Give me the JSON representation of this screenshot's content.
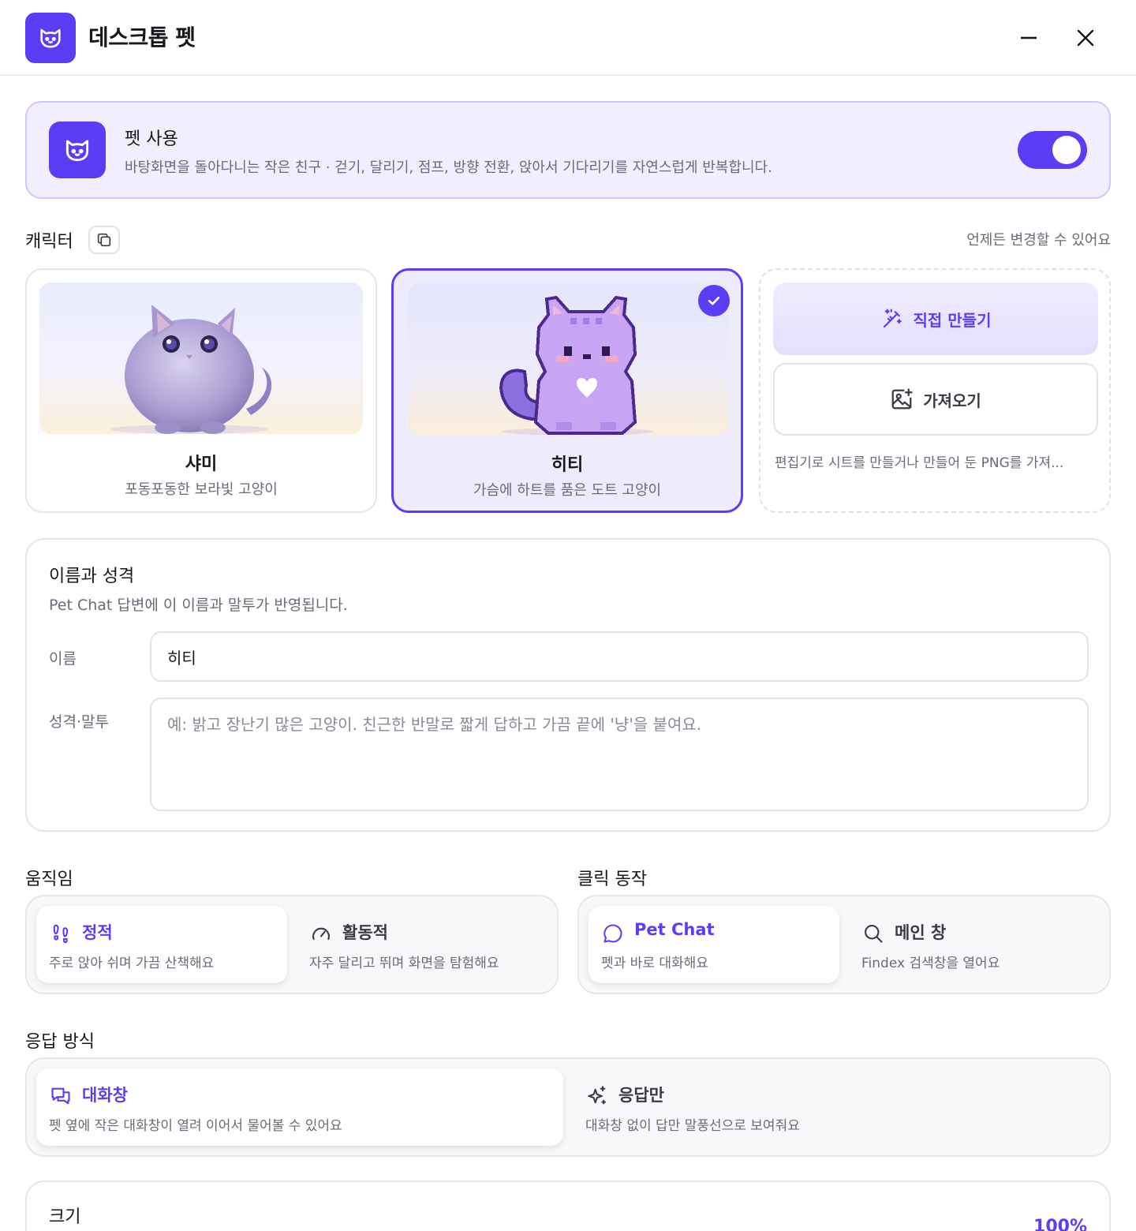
{
  "app": {
    "title": "데스크톱 펫"
  },
  "enable": {
    "title": "펫 사용",
    "description": "바탕화면을 돌아다니는 작은 친구 · 걷기, 달리기, 점프, 방향 전환, 앉아서 기다리기를 자연스럽게 반복합니다.",
    "enabled": true
  },
  "character": {
    "label": "캐릭터",
    "hint": "언제든 변경할 수 있어요",
    "cards": [
      {
        "name": "샤미",
        "description": "포동포동한 보라빛 고양이",
        "selected": false
      },
      {
        "name": "히티",
        "description": "가슴에 하트를 품은 도트 고양이",
        "selected": true
      }
    ],
    "create": {
      "make_label": "직접 만들기",
      "import_label": "가져오기",
      "hint": "편집기로 시트를 만들거나 만들어 둔 PNG를 가져..."
    }
  },
  "identity": {
    "title": "이름과 성격",
    "subtitle": "Pet Chat 답변에 이 이름과 말투가 반영됩니다.",
    "name_label": "이름",
    "name_value": "히티",
    "personality_label": "성격·말투",
    "personality_placeholder": "예: 밝고 장난기 많은 고양이. 친근한 반말로 짧게 답하고 가끔 끝에 '냥'을 붙여요."
  },
  "movement": {
    "label": "움직임",
    "options": [
      {
        "title": "정적",
        "description": "주로 앉아 쉬며 가끔 산책해요",
        "icon": "footprints-icon",
        "selected": true
      },
      {
        "title": "활동적",
        "description": "자주 달리고 뛰며 화면을 탐험해요",
        "icon": "gauge-icon",
        "selected": false
      }
    ]
  },
  "click_action": {
    "label": "클릭 동작",
    "options": [
      {
        "title": "Pet Chat",
        "description": "펫과 바로 대화해요",
        "icon": "chat-bubble-icon",
        "selected": true
      },
      {
        "title": "메인 창",
        "description": "Findex 검색창을 열어요",
        "icon": "search-icon",
        "selected": false
      }
    ]
  },
  "response": {
    "label": "응답 방식",
    "options": [
      {
        "title": "대화창",
        "description": "펫 옆에 작은 대화창이 열려 이어서 물어볼 수 있어요",
        "icon": "chat-window-icon",
        "selected": true
      },
      {
        "title": "응답만",
        "description": "대화창 없이 답만 말풍선으로 보여줘요",
        "icon": "sparkles-icon",
        "selected": false
      }
    ]
  },
  "size": {
    "title": "크기",
    "value": "100%"
  },
  "colors": {
    "accent": "#5b3df5",
    "accent_soft": "#f1eefe",
    "text_muted": "#6a6a78"
  }
}
